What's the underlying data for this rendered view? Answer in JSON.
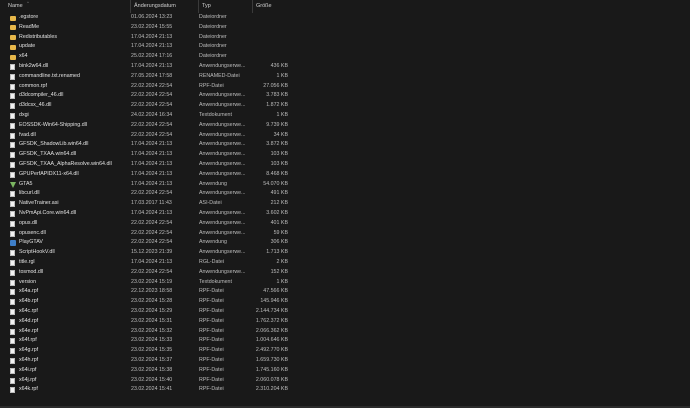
{
  "columns": {
    "name": "Name",
    "date": "Änderungsdatum",
    "type": "Typ",
    "size": "Größe",
    "sort_indicator": "^"
  },
  "files": [
    {
      "name": ".egstore",
      "date": "01.06.2024 13:23",
      "type": "Dateiordner",
      "size": "",
      "icon": "folder-icon"
    },
    {
      "name": "ReadMe",
      "date": "23.02.2024 15:55",
      "type": "Dateiordner",
      "size": "",
      "icon": "folder-icon"
    },
    {
      "name": "Redistributables",
      "date": "17.04.2024 21:13",
      "type": "Dateiordner",
      "size": "",
      "icon": "folder-icon"
    },
    {
      "name": "update",
      "date": "17.04.2024 21:13",
      "type": "Dateiordner",
      "size": "",
      "icon": "folder-icon"
    },
    {
      "name": "x64",
      "date": "25.02.2024 17:16",
      "type": "Dateiordner",
      "size": "",
      "icon": "folder-icon"
    },
    {
      "name": "bink2w64.dll",
      "date": "17.04.2024 21:13",
      "type": "Anwendungserwe...",
      "size": "436 KB",
      "icon": "doc-icon"
    },
    {
      "name": "commandline.txt.renamed",
      "date": "27.05.2024 17:58",
      "type": "RENAMED-Datei",
      "size": "1 KB",
      "icon": "doc-icon"
    },
    {
      "name": "common.rpf",
      "date": "22.02.2024 22:54",
      "type": "RPF-Datei",
      "size": "27.056 KB",
      "icon": "doc-icon"
    },
    {
      "name": "d3dcompiler_46.dll",
      "date": "22.02.2024 22:54",
      "type": "Anwendungserwe...",
      "size": "3.783 KB",
      "icon": "doc-icon"
    },
    {
      "name": "d3dcsx_46.dll",
      "date": "22.02.2024 22:54",
      "type": "Anwendungserwe...",
      "size": "1.872 KB",
      "icon": "doc-icon"
    },
    {
      "name": "dxgi",
      "date": "24.02.2024 16:34",
      "type": "Textdokument",
      "size": "1 KB",
      "icon": "doc-icon"
    },
    {
      "name": "EOSSDK-Win64-Shipping.dll",
      "date": "22.02.2024 22:54",
      "type": "Anwendungserwe...",
      "size": "9.739 KB",
      "icon": "doc-icon"
    },
    {
      "name": "fvad.dll",
      "date": "22.02.2024 22:54",
      "type": "Anwendungserwe...",
      "size": "34 KB",
      "icon": "doc-icon"
    },
    {
      "name": "GFSDK_ShadowLib.win64.dll",
      "date": "17.04.2024 21:13",
      "type": "Anwendungserwe...",
      "size": "3.872 KB",
      "icon": "doc-icon"
    },
    {
      "name": "GFSDK_TXAA.win64.dll",
      "date": "17.04.2024 21:13",
      "type": "Anwendungserwe...",
      "size": "103 KB",
      "icon": "doc-icon"
    },
    {
      "name": "GFSDK_TXAA_AlphaResolve.win64.dll",
      "date": "17.04.2024 21:13",
      "type": "Anwendungserwe...",
      "size": "103 KB",
      "icon": "doc-icon"
    },
    {
      "name": "GPUPerfAPIDX11-x64.dll",
      "date": "17.04.2024 21:13",
      "type": "Anwendungserwe...",
      "size": "8.468 KB",
      "icon": "doc-icon"
    },
    {
      "name": "GTA5",
      "date": "17.04.2024 21:13",
      "type": "Anwendung",
      "size": "54.070 KB",
      "icon": "game-icon"
    },
    {
      "name": "libcurl.dll",
      "date": "22.02.2024 22:54",
      "type": "Anwendungserwe...",
      "size": "491 KB",
      "icon": "doc-icon"
    },
    {
      "name": "NativeTrainer.asi",
      "date": "17.03.2017 11:43",
      "type": "ASI-Datei",
      "size": "212 KB",
      "icon": "doc-icon"
    },
    {
      "name": "NvPmApi.Core.win64.dll",
      "date": "17.04.2024 21:13",
      "type": "Anwendungserwe...",
      "size": "3.602 KB",
      "icon": "doc-icon"
    },
    {
      "name": "opus.dll",
      "date": "22.02.2024 22:54",
      "type": "Anwendungserwe...",
      "size": "401 KB",
      "icon": "doc-icon"
    },
    {
      "name": "opusenc.dll",
      "date": "22.02.2024 22:54",
      "type": "Anwendungserwe...",
      "size": "59 KB",
      "icon": "doc-icon"
    },
    {
      "name": "PlayGTAV",
      "date": "22.02.2024 22:54",
      "type": "Anwendung",
      "size": "306 KB",
      "icon": "app-icon"
    },
    {
      "name": "ScriptHookV.dll",
      "date": "15.12.2023 21:39",
      "type": "Anwendungserwe...",
      "size": "1.713 KB",
      "icon": "doc-icon"
    },
    {
      "name": "title.rgl",
      "date": "17.04.2024 21:13",
      "type": "RGL-Datei",
      "size": "2 KB",
      "icon": "doc-icon"
    },
    {
      "name": "tosmod.dll",
      "date": "22.02.2024 22:54",
      "type": "Anwendungserwe...",
      "size": "152 KB",
      "icon": "doc-icon"
    },
    {
      "name": "version",
      "date": "23.02.2024 15:19",
      "type": "Textdokument",
      "size": "1 KB",
      "icon": "doc-icon"
    },
    {
      "name": "x64a.rpf",
      "date": "22.12.2023 18:58",
      "type": "RPF-Datei",
      "size": "47.566 KB",
      "icon": "doc-icon"
    },
    {
      "name": "x64b.rpf",
      "date": "23.02.2024 15:28",
      "type": "RPF-Datei",
      "size": "145.946 KB",
      "icon": "doc-icon"
    },
    {
      "name": "x64c.rpf",
      "date": "23.02.2024 15:29",
      "type": "RPF-Datei",
      "size": "2.144.734 KB",
      "icon": "doc-icon"
    },
    {
      "name": "x64d.rpf",
      "date": "23.02.2024 15:31",
      "type": "RPF-Datei",
      "size": "1.762.372 KB",
      "icon": "doc-icon"
    },
    {
      "name": "x64e.rpf",
      "date": "23.02.2024 15:32",
      "type": "RPF-Datei",
      "size": "2.066.362 KB",
      "icon": "doc-icon"
    },
    {
      "name": "x64f.rpf",
      "date": "23.02.2024 15:33",
      "type": "RPF-Datei",
      "size": "1.004.646 KB",
      "icon": "doc-icon"
    },
    {
      "name": "x64g.rpf",
      "date": "23.02.2024 15:35",
      "type": "RPF-Datei",
      "size": "2.492.770 KB",
      "icon": "doc-icon"
    },
    {
      "name": "x64h.rpf",
      "date": "23.02.2024 15:37",
      "type": "RPF-Datei",
      "size": "1.659.730 KB",
      "icon": "doc-icon"
    },
    {
      "name": "x64i.rpf",
      "date": "23.02.2024 15:38",
      "type": "RPF-Datei",
      "size": "1.745.160 KB",
      "icon": "doc-icon"
    },
    {
      "name": "x64j.rpf",
      "date": "23.02.2024 15:40",
      "type": "RPF-Datei",
      "size": "2.060.078 KB",
      "icon": "doc-icon"
    },
    {
      "name": "x64k.rpf",
      "date": "23.02.2024 15:41",
      "type": "RPF-Datei",
      "size": "2.310.204 KB",
      "icon": "doc-icon"
    }
  ]
}
